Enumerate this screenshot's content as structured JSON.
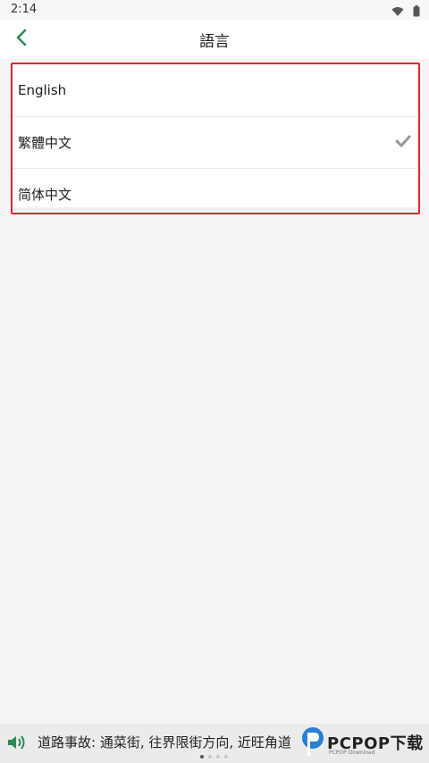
{
  "status_bar": {
    "time": "2:14",
    "icons": [
      "wifi-icon",
      "battery-icon"
    ]
  },
  "app_bar": {
    "title": "語言",
    "back_icon": "chevron-left-icon",
    "accent_color": "#2e8b57"
  },
  "languages": [
    {
      "label": "English",
      "selected": false
    },
    {
      "label": "繁體中文",
      "selected": true
    },
    {
      "label": "简体中文",
      "selected": false
    }
  ],
  "highlight_color": "#e5232b",
  "bottom_bar": {
    "ticker": "道路事故: 通菜街, 往界限街方向, 近旺角道",
    "page_dots": 4,
    "active_dot": 0
  },
  "watermark": {
    "text": "PCPOP下载",
    "sub": "PCPOP Download"
  }
}
